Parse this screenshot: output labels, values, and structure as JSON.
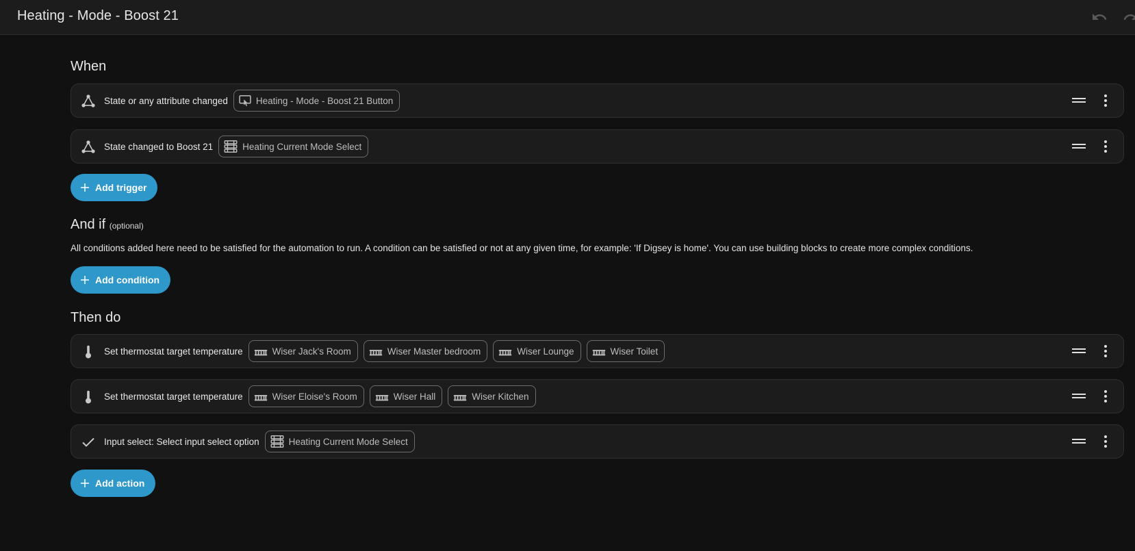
{
  "header": {
    "title": "Heating - Mode - Boost 21",
    "undo_icon": "undo-icon",
    "redo_icon": "redo-icon"
  },
  "when": {
    "title": "When",
    "triggers": [
      {
        "icon": "state-trigger-icon",
        "label": "State or any attribute changed",
        "chips": [
          {
            "icon": "button-icon",
            "label": "Heating - Mode - Boost 21 Button"
          }
        ]
      },
      {
        "icon": "state-trigger-icon",
        "label": "State changed to Boost 21",
        "chips": [
          {
            "icon": "select-icon",
            "label": "Heating Current Mode Select"
          }
        ]
      }
    ],
    "add_label": "Add trigger"
  },
  "and_if": {
    "title": "And if",
    "optional": "(optional)",
    "description": "All conditions added here need to be satisfied for the automation to run. A condition can be satisfied or not at any given time, for example: 'If Digsey is home'. You can use building blocks to create more complex conditions.",
    "add_label": "Add condition"
  },
  "then_do": {
    "title": "Then do",
    "actions": [
      {
        "icon": "thermometer-icon",
        "label": "Set thermostat target temperature",
        "chips": [
          {
            "icon": "radiator-icon",
            "label": "Wiser Jack's Room"
          },
          {
            "icon": "radiator-icon",
            "label": "Wiser Master bedroom"
          },
          {
            "icon": "radiator-icon",
            "label": "Wiser Lounge"
          },
          {
            "icon": "radiator-icon",
            "label": "Wiser Toilet"
          }
        ]
      },
      {
        "icon": "thermometer-icon",
        "label": "Set thermostat target temperature",
        "chips": [
          {
            "icon": "radiator-icon",
            "label": "Wiser Eloise's Room"
          },
          {
            "icon": "radiator-icon",
            "label": "Wiser Hall"
          },
          {
            "icon": "radiator-icon",
            "label": "Wiser Kitchen"
          }
        ]
      },
      {
        "icon": "check-icon",
        "label": "Input select: Select input select option",
        "chips": [
          {
            "icon": "select-icon",
            "label": "Heating Current Mode Select"
          }
        ]
      }
    ],
    "add_label": "Add action"
  },
  "colors": {
    "background": "#111111",
    "card": "#1c1c1c",
    "accent": "#2d98c9"
  }
}
